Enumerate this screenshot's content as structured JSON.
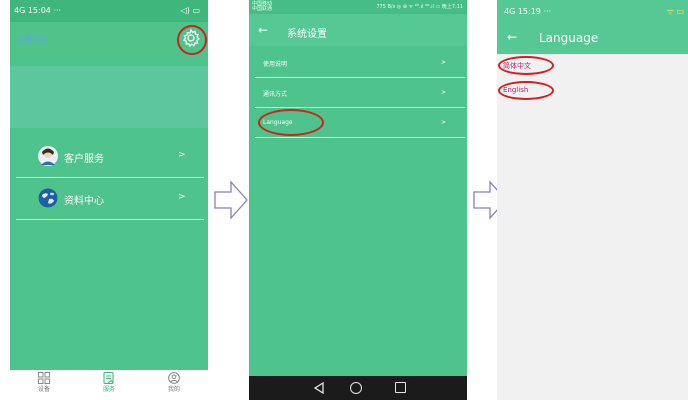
{
  "phone1": {
    "status_time": "15:04",
    "status_signal": "4G",
    "status_right": "◁) ▭",
    "header_title": "设备中心",
    "menu": [
      {
        "label": "客户服务",
        "chevron": ">",
        "icon": "customer-avatar-icon"
      },
      {
        "label": "资料中心",
        "chevron": ">",
        "icon": "globe-icon"
      }
    ],
    "tabs": [
      {
        "label": "设备",
        "icon": "grid-icon",
        "active": false
      },
      {
        "label": "服务",
        "icon": "service-icon",
        "active": true
      },
      {
        "label": "我的",
        "icon": "user-icon",
        "active": false
      }
    ]
  },
  "phone2": {
    "status_carrier_1": "中国移动",
    "status_carrier_2": "中国联通",
    "status_right": "775 B/s ◎ ⊕ ᯤ ⁴ᴳ.ıl ⁴ᴳ.ıl ▭ 晚上7:11",
    "back_glyph": "←",
    "title": "系统设置",
    "rows": [
      {
        "label": "使用说明",
        "chevron": ">"
      },
      {
        "label": "通讯方式",
        "chevron": ">"
      },
      {
        "label": "Language",
        "chevron": ">"
      }
    ]
  },
  "phone3": {
    "status_time": "15:19",
    "status_signal": "4G",
    "status_right": "ᯤ ▭",
    "back_glyph": "←",
    "title": "Language",
    "options": [
      "简体中文",
      "English"
    ]
  },
  "colors": {
    "primary_green": "#4ec38b",
    "header_green": "#55c894",
    "highlight_red": "#d21f1f",
    "option_text": "#b51f6c"
  }
}
